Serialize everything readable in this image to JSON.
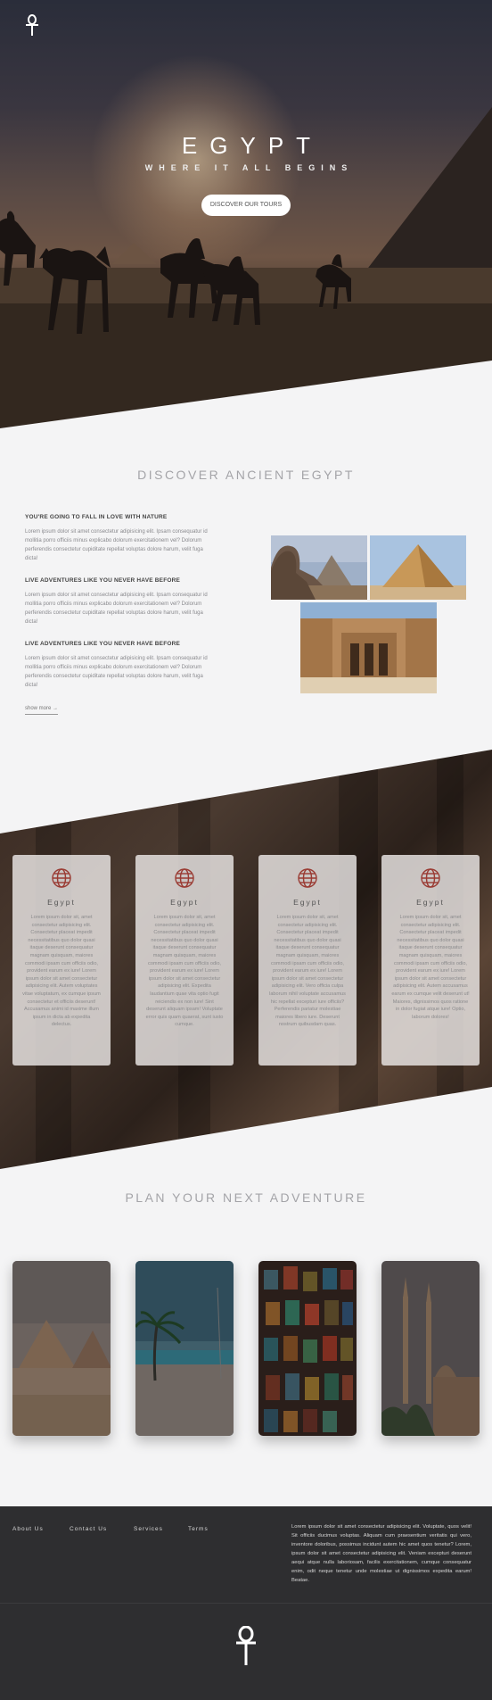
{
  "hero": {
    "title": "EGYPT",
    "subtitle": "WHERE IT ALL BEGINS",
    "button": "DISCOVER OUR TOURS"
  },
  "discover": {
    "title": "DISCOVER ANCIENT EGYPT",
    "blocks": [
      {
        "heading": "YOU'RE GOING TO FALL IN LOVE WITH NATURE",
        "body": "Lorem ipsum dolor sit amet consectetur adipisicing elit. Ipsam consequatur id mollitia porro officiis minus explicabo dolorum exercitationem vel? Dolorum perferendis consectetur cupiditate repellat voluptas dolore harum, velit fuga dicta!"
      },
      {
        "heading": "LIVE ADVENTURES LIKE YOU NEVER HAVE BEFORE",
        "body": "Lorem ipsum dolor sit amet consectetur adipisicing elit. Ipsam consequatur id mollitia porro officiis minus explicabo dolorum exercitationem vel? Dolorum perferendis consectetur cupiditate repellat voluptas dolore harum, velit fuga dicta!"
      },
      {
        "heading": "LIVE ADVENTURES LIKE YOU NEVER HAVE BEFORE",
        "body": "Lorem ipsum dolor sit amet consectetur adipisicing elit. Ipsam consequatur id mollitia porro officiis minus explicabo dolorum exercitationem vel? Dolorum perferendis consectetur cupiditate repellat voluptas dolore harum, velit fuga dicta!"
      }
    ],
    "show_more": "show more →"
  },
  "cards": [
    {
      "title": "Egypt",
      "body": "Lorem ipsum dolor sit, amet consectetur adipisicing elit. Consectetur placeat impedit necessitatibus quo dolor quasi itaque deserunt consequatur magnam quisquam, maiores commodi ipsam cum officiis odio, provident earum ex iure! Lorem ipsum dolor sit amet consectetur adipisicing elit. Autem voluptates vitae voluptatum, ex cumque ipsum consectetur et officiis deserunt! Accusamus animi id maxime illum ipsum in dicta ab expedita delectus."
    },
    {
      "title": "Egypt",
      "body": "Lorem ipsum dolor sit, amet consectetur adipisicing elit. Consectetur placeat impedit necessitatibus quo dolor quasi itaque deserunt consequatur magnam quisquam, maiores commodi ipsam cum officiis odio, provident earum ex iure! Lorem ipsum dolor sit amet consectetur adipisicing elit. Expedita laudantium quae vita optio fugit reiciendis ex non iure! Sint deserunt aliquam ipsam! Voluptate error quis quam quaerat, sunt iusto cumque."
    },
    {
      "title": "Egypt",
      "body": "Lorem ipsum dolor sit, amet consectetur adipisicing elit. Consectetur placeat impedit necessitatibus quo dolor quasi itaque deserunt consequatur magnam quisquam, maiores commodi ipsam cum officiis odio, provident earum ex iure! Lorem ipsum dolor sit amet consectetur adipisicing elit. Vero officia culpa laborum nihil voluptate accusamus hic repellat excepturi iure officiis? Perferendis pariatur molestiae maiores libero iure. Deserunt nostrum quibusdam quas."
    },
    {
      "title": "Egypt",
      "body": "Lorem ipsum dolor sit, amet consectetur adipisicing elit. Consectetur placeat impedit necessitatibus quo dolor quasi itaque deserunt consequatur magnam quisquam, maiores commodi ipsam cum officiis odio, provident earum ex iure! Lorem ipsum dolor sit amet consectetur adipisicing elit. Autem accusamus earum ex cumque velit deserunt ut! Maiores, dignissimos quos ratione in dolor fugiat atque iure! Optio, laborum dolores!"
    }
  ],
  "plan": {
    "title": "PLAN YOUR NEXT ADVENTURE",
    "tiles": [
      "pyramids",
      "beach",
      "lanterns",
      "mosque"
    ]
  },
  "footer": {
    "links": [
      "About Us",
      "Contact Us",
      "Services",
      "Terms"
    ],
    "text": "Lorem ipsum dolor sit amet consectetur adipisicing elit. Voluptate, quos velit! Sit officiis ducimus voluptas. Aliquam cum praesentium veritatis qui vero, inventore doloribus, possimus incidunt autem hic amet quos tenetur? Lorem, ipsum dolor sit amet consectetur adipisicing elit. Veniam excepturi deserunt aequi atque nulla laboriosam, facilis exercitationem, cumque consequatur enim, odit neque tenetur unde molestiae ut dignissimos expedita earum! Beatae."
  },
  "icons": {
    "logo": "ankh-icon",
    "card_icon": "globe-icon"
  },
  "colors": {
    "accent": "#9a3b33",
    "footer": "#2e2e30",
    "title_gray": "#a4a4a8"
  }
}
